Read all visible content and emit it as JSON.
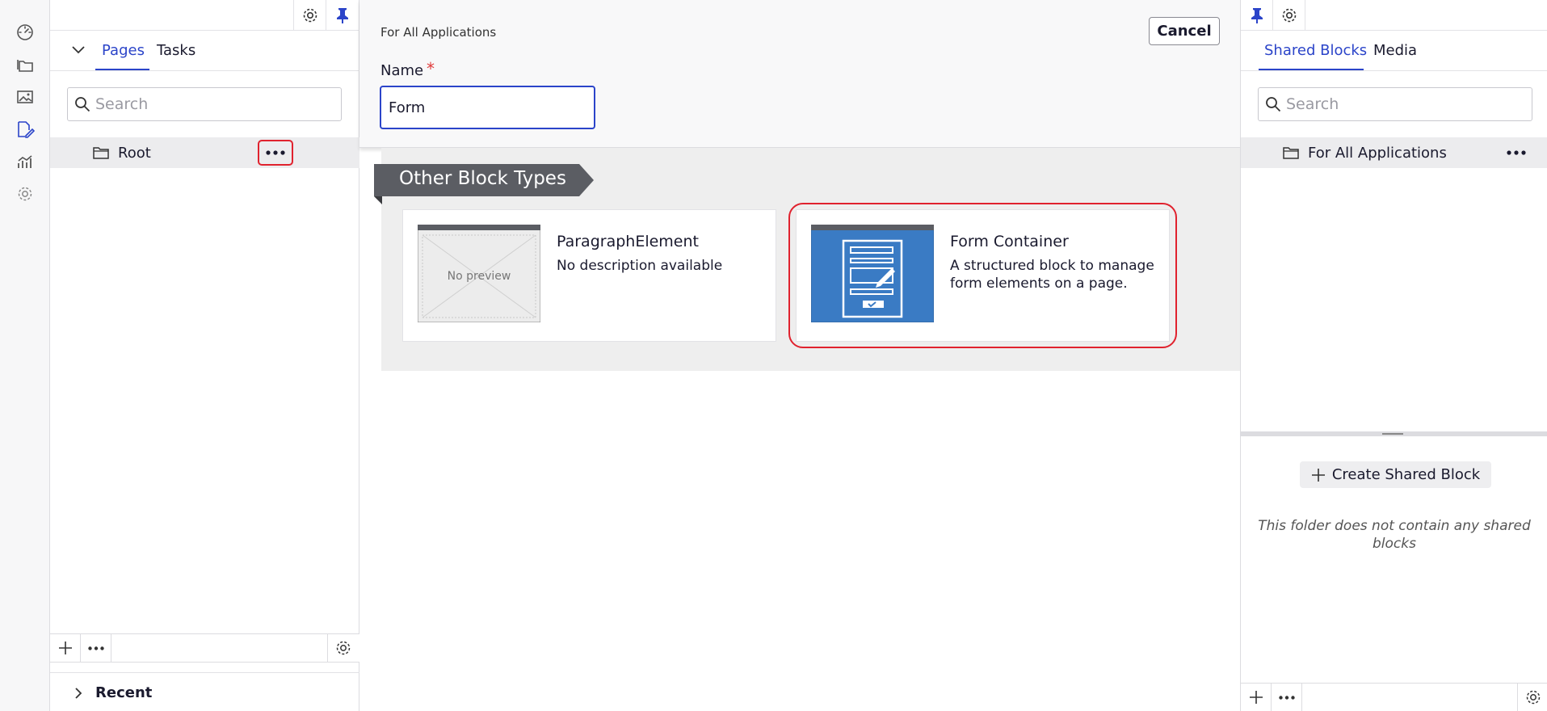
{
  "rail": {
    "icons": [
      "dashboard-icon",
      "folder-icon",
      "image-icon",
      "edit-page-icon",
      "analytics-icon",
      "settings-icon"
    ]
  },
  "pages_panel": {
    "tabs": [
      {
        "label": "Pages",
        "active": true
      },
      {
        "label": "Tasks",
        "active": false
      }
    ],
    "search": {
      "placeholder": "Search",
      "value": ""
    },
    "tree": [
      {
        "label": "Root"
      }
    ],
    "footer": {
      "section": "Recent"
    }
  },
  "editor": {
    "breadcrumb": "For All Applications",
    "cancel_label": "Cancel",
    "name_label": "Name",
    "required_marker": "*",
    "name_value": "Form",
    "section_title": "Other Block Types",
    "blocks": [
      {
        "title": "ParagraphElement",
        "description": "No description available",
        "preview_text": "No preview"
      },
      {
        "title": "Form Container",
        "description": "A structured block to manage form elements on a page."
      }
    ]
  },
  "shared_panel": {
    "tabs": [
      {
        "label": "Shared Blocks",
        "active": true
      },
      {
        "label": "Media",
        "active": false
      }
    ],
    "search": {
      "placeholder": "Search",
      "value": ""
    },
    "tree": [
      {
        "label": "For All Applications"
      }
    ],
    "create_label": "Create Shared Block",
    "empty_message": "This folder does not contain any shared blocks"
  },
  "colors": {
    "accent": "#2b44c9",
    "highlight": "#e0222e",
    "ribbon": "#5b5d63",
    "form_thumb": "#3a7bc4"
  }
}
